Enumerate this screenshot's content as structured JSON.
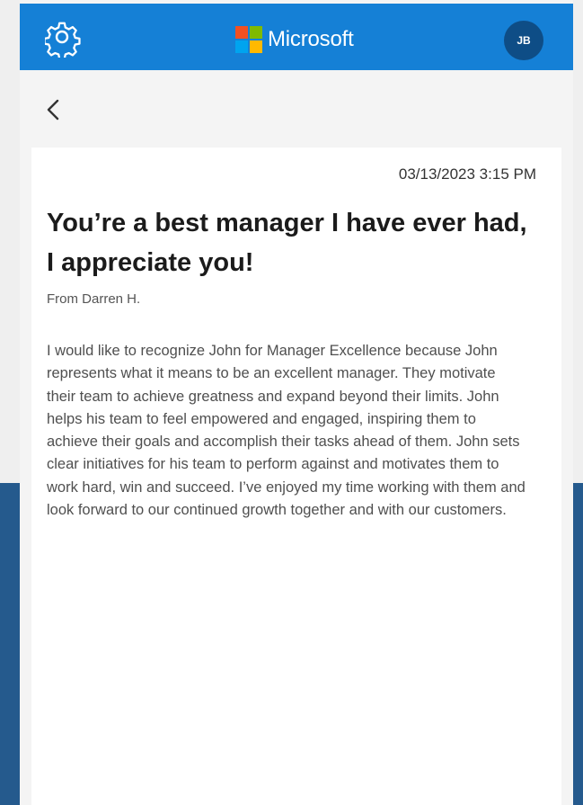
{
  "app": {
    "brand": "Microsoft",
    "avatar_initials": "JB",
    "colors": {
      "header": "#1580d6",
      "avatar": "#0e4d86",
      "backdrop_bottom": "#255a8d",
      "logo_red": "#f25022",
      "logo_green": "#7fba00",
      "logo_blue": "#00a4ef",
      "logo_yellow": "#ffb900"
    }
  },
  "icons": {
    "settings": "gear-icon",
    "back": "chevron-left-icon"
  },
  "message": {
    "timestamp": "03/13/2023 3:15 PM",
    "title": "You’re a best manager I have ever had, I appreciate you!",
    "from": "From Darren H.",
    "body": "I would like to recognize John for Manager Excellence because John represents what it means to be an excellent manager. They motivate their team to achieve greatness and expand beyond their limits. John helps his team to feel empowered and engaged, inspiring them to achieve their goals and accomplish their tasks ahead of them. John sets clear initiatives for his team to perform against and motivates them to work hard, win and succeed. I’ve enjoyed my time working with them and look forward to our continued growth together and with our customers."
  }
}
